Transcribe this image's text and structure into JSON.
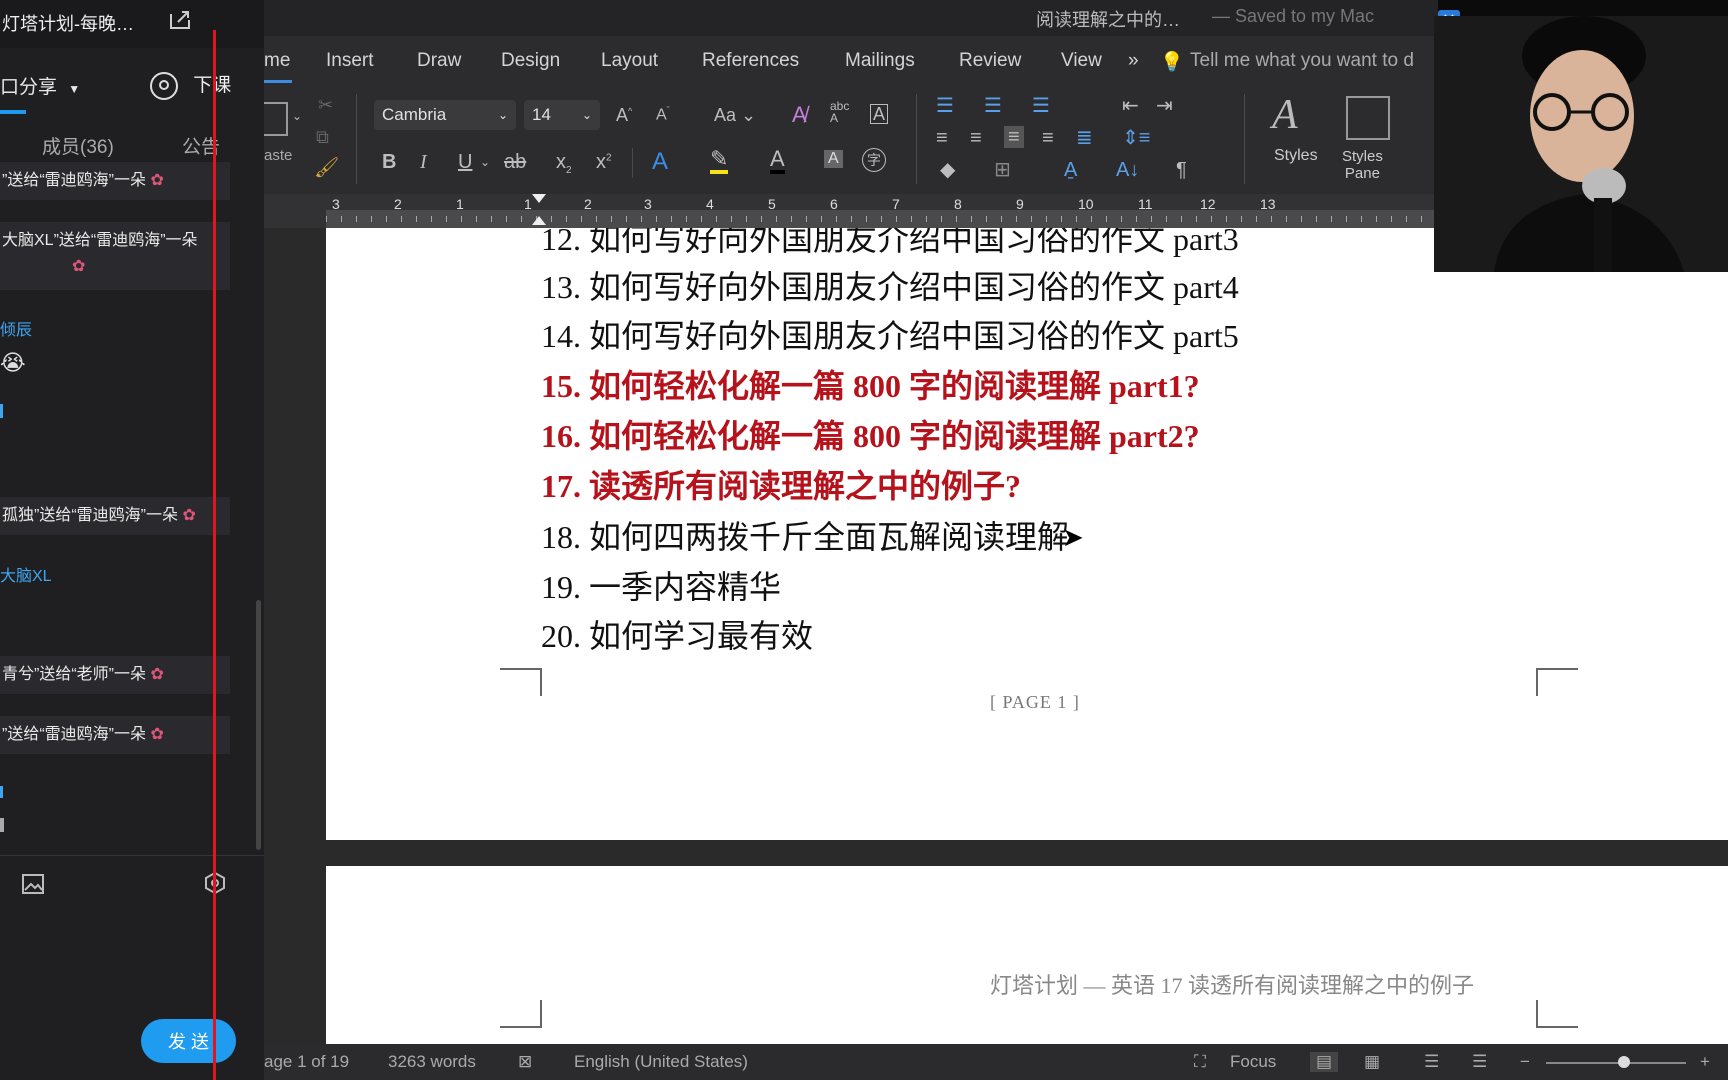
{
  "chat": {
    "title": "灯塔计划-每晚…",
    "tab_share": "口分享",
    "end_class": "下课",
    "members": "成员(36)",
    "notice": "公告",
    "messages": [
      "”送给“雷迪鸥海”一朵",
      "大脑XL”送给“雷迪鸥海”一朵",
      "孤独”送给“雷迪鸥海”一朵",
      "青兮”送给“老师”一朵",
      "”送给“雷迪鸥海”一朵"
    ],
    "names": [
      "倾辰",
      "大脑XL"
    ],
    "send": "发 送"
  },
  "word": {
    "doc_title": "阅读理解之中的…",
    "saved": "— Saved to my Mac",
    "tabs": [
      "me",
      "Insert",
      "Draw",
      "Design",
      "Layout",
      "References",
      "Mailings",
      "Review",
      "View"
    ],
    "tell_me": "Tell me what you want to d",
    "font_name": "Cambria",
    "font_size": "14",
    "paste": "aste",
    "styles": "Styles",
    "styles_pane": "Styles\nPane",
    "ruler": [
      "3",
      "2",
      "1",
      "1",
      "2",
      "3",
      "4",
      "5",
      "6",
      "7",
      "8",
      "9",
      "10",
      "11",
      "12",
      "13"
    ],
    "lines": [
      {
        "text": "12.  如何写好向外国朋友介绍中国习俗的作文  part3",
        "red": false
      },
      {
        "text": "13.  如何写好向外国朋友介绍中国习俗的作文  part4",
        "red": false
      },
      {
        "text": "14.  如何写好向外国朋友介绍中国习俗的作文  part5",
        "red": false
      },
      {
        "text": "15.  如何轻松化解一篇 800 字的阅读理解  part1?",
        "red": true
      },
      {
        "text": "16.  如何轻松化解一篇 800 字的阅读理解  part2?",
        "red": true
      },
      {
        "text": "17.  读透所有阅读理解之中的例子?",
        "red": true
      },
      {
        "text": "18.  如何四两拨千斤全面瓦解阅读理解",
        "red": false
      },
      {
        "text": "19.  一季内容精华",
        "red": false
      },
      {
        "text": "20.  如何学习最有效",
        "red": false
      }
    ],
    "page_label": "[ PAGE 1 ]",
    "page2_header": "灯塔计划 — 英语 17  读透所有阅读理解之中的例子",
    "status": {
      "page": "age 1 of 19",
      "words": "3263 words",
      "lang": "English (United States)",
      "focus": "Focus"
    }
  }
}
